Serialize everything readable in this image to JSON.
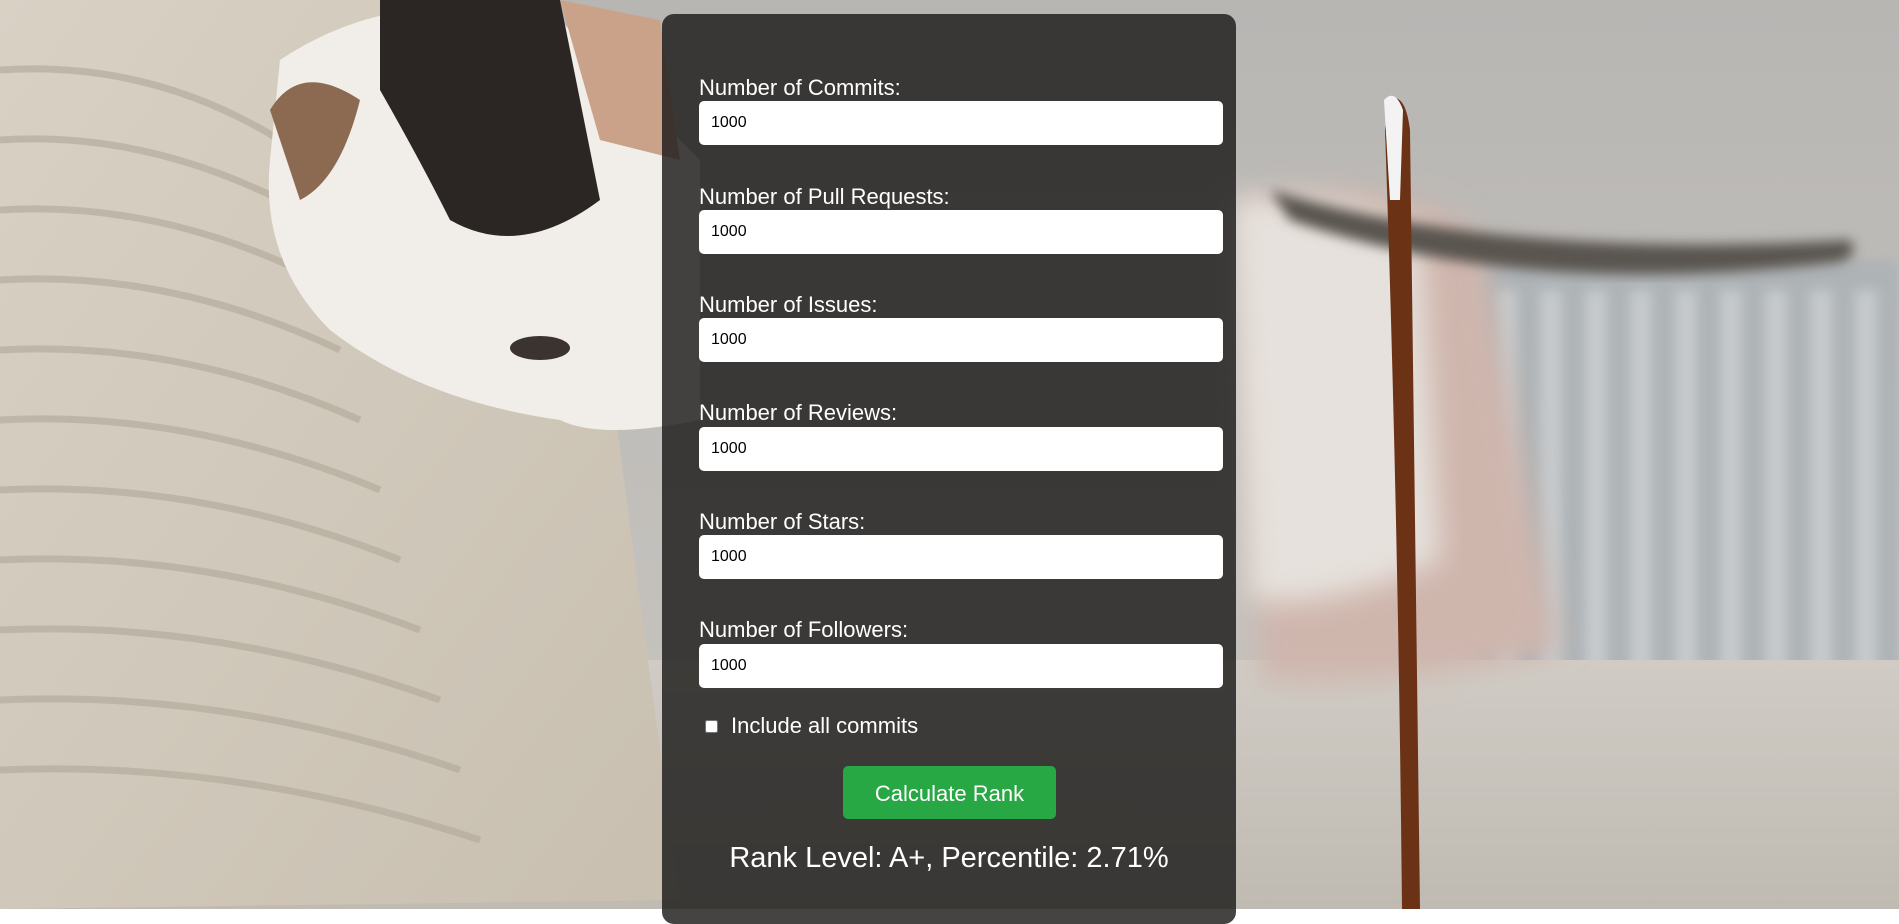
{
  "colors": {
    "panel_bg": "#1c1b1a",
    "button_bg": "#28a745",
    "text": "#ffffff",
    "input_bg": "#ffffff"
  },
  "background": {
    "icon": "cat-photo-background"
  },
  "form": {
    "fields": [
      {
        "label": "Number of Commits:",
        "value": "1000"
      },
      {
        "label": "Number of Pull Requests:",
        "value": "1000"
      },
      {
        "label": "Number of Issues:",
        "value": "1000"
      },
      {
        "label": "Number of Reviews:",
        "value": "1000"
      },
      {
        "label": "Number of Stars:",
        "value": "1000"
      },
      {
        "label": "Number of Followers:",
        "value": "1000"
      }
    ],
    "checkbox": {
      "label": "Include all commits",
      "checked": false
    },
    "button_label": "Calculate Rank",
    "result": "Rank Level: A+, Percentile: 2.71%"
  }
}
